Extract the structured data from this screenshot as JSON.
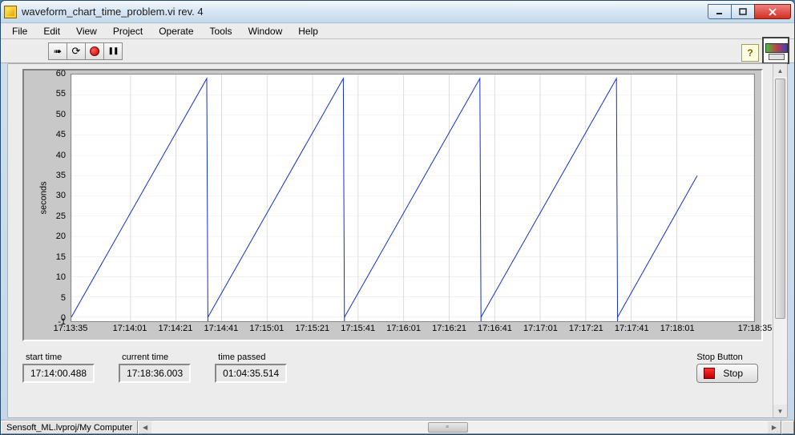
{
  "window": {
    "title": "waveform_chart_time_problem.vi rev. 4"
  },
  "menu": {
    "items": [
      "File",
      "Edit",
      "View",
      "Project",
      "Operate",
      "Tools",
      "Window",
      "Help"
    ]
  },
  "toolbar": {
    "help": "?"
  },
  "chart_data": {
    "type": "line",
    "ylabel": "seconds",
    "ylim": [
      -1,
      60
    ],
    "y_ticks": [
      -1,
      0,
      5,
      10,
      15,
      20,
      25,
      30,
      35,
      40,
      45,
      50,
      55,
      60
    ],
    "x_ticks": [
      "17:13:35",
      "17:14:01",
      "17:14:21",
      "17:14:41",
      "17:15:01",
      "17:15:21",
      "17:15:41",
      "17:16:01",
      "17:16:21",
      "17:16:41",
      "17:17:01",
      "17:17:21",
      "17:17:41",
      "17:18:01",
      "17:18:35"
    ],
    "x_range_seconds": [
      0,
      300
    ],
    "x_tick_seconds": [
      0,
      26,
      46,
      66,
      86,
      106,
      126,
      146,
      166,
      186,
      206,
      226,
      246,
      266,
      300
    ],
    "series": [
      {
        "name": "seconds",
        "color": "#1030d0",
        "segments": [
          {
            "x0": 0,
            "y0": 0,
            "x1": 59.5,
            "y1": 59
          },
          {
            "x0": 60,
            "y0": -1,
            "x1": 60,
            "y1": -1
          },
          {
            "x0": 60,
            "y0": 0,
            "x1": 119.5,
            "y1": 59
          },
          {
            "x0": 120,
            "y0": -1,
            "x1": 120,
            "y1": -1
          },
          {
            "x0": 120,
            "y0": 0,
            "x1": 179.5,
            "y1": 59
          },
          {
            "x0": 180,
            "y0": -1,
            "x1": 180,
            "y1": -1
          },
          {
            "x0": 180,
            "y0": 0,
            "x1": 239.5,
            "y1": 59
          },
          {
            "x0": 240,
            "y0": -1,
            "x1": 240,
            "y1": -1
          },
          {
            "x0": 240,
            "y0": 0,
            "x1": 275,
            "y1": 35
          }
        ]
      }
    ]
  },
  "fields": {
    "start_time": {
      "label": "start time",
      "value": "17:14:00.488"
    },
    "current_time": {
      "label": "current time",
      "value": "17:18:36.003"
    },
    "time_passed": {
      "label": "time passed",
      "value": "01:04:35.514"
    }
  },
  "stop": {
    "label": "Stop Button",
    "button": "Stop"
  },
  "status": {
    "path": "Sensoft_ML.lvproj/My Computer"
  }
}
